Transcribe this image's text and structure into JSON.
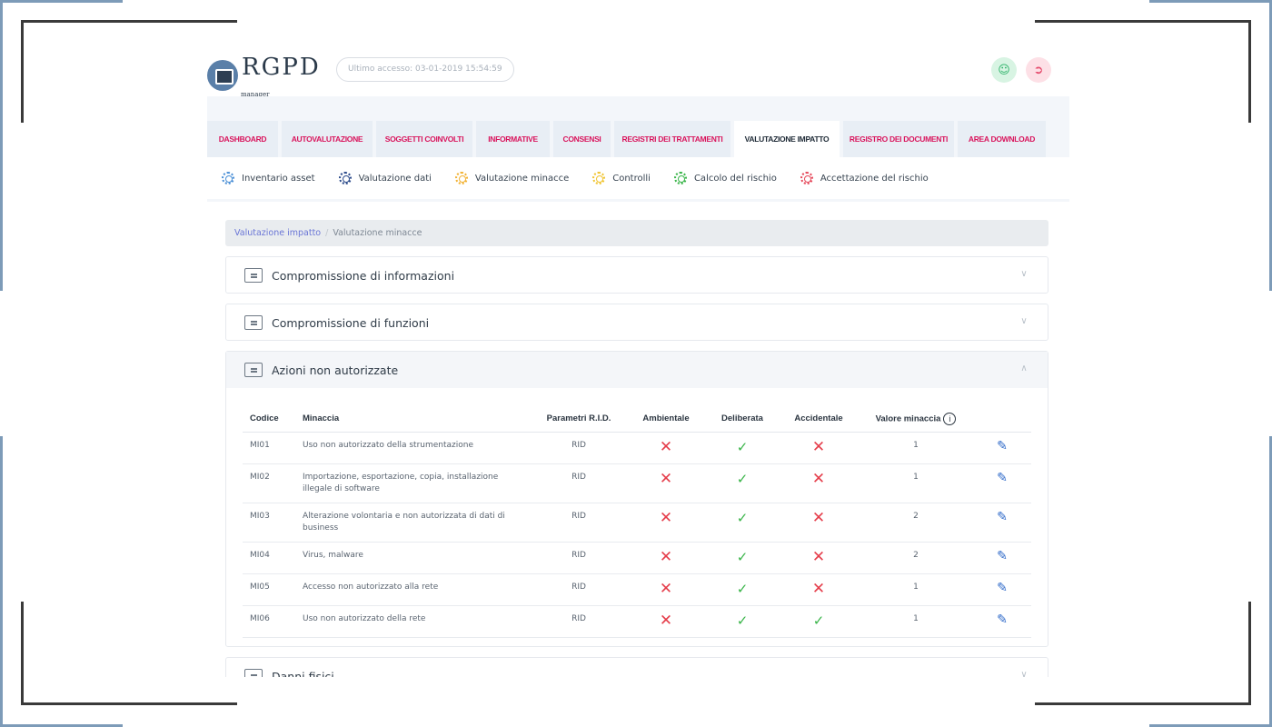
{
  "header": {
    "logo_text": "RGPD",
    "logo_sub": "manager",
    "last_access": "Ultimo accesso: 03-01-2019 15:54:59",
    "colors": {
      "user_btn": "#2fb36a",
      "logout_btn": "#e5486a"
    }
  },
  "tabs": [
    {
      "label": "DASHBOARD"
    },
    {
      "label": "AUTOVALUTAZIONE"
    },
    {
      "label": "SOGGETTI COINVOLTI"
    },
    {
      "label": "INFORMATIVE"
    },
    {
      "label": "CONSENSI"
    },
    {
      "label": "REGISTRI DEI TRATTAMENTI"
    },
    {
      "label": "VALUTAZIONE IMPATTO"
    },
    {
      "label": "REGISTRO DEI DOCUMENTI"
    },
    {
      "label": "AREA DOWNLOAD"
    }
  ],
  "active_tab": "VALUTAZIONE IMPATTO",
  "subnav": [
    {
      "label": "Inventario asset",
      "color": "#4a8fd6"
    },
    {
      "label": "Valutazione dati",
      "color": "#2b4a8a"
    },
    {
      "label": "Valutazione minacce",
      "color": "#f2b233"
    },
    {
      "label": "Controlli",
      "color": "#f0c431"
    },
    {
      "label": "Calcolo del rischio",
      "color": "#3ab54a"
    },
    {
      "label": "Accettazione del rischio",
      "color": "#e5485a"
    }
  ],
  "breadcrumb": {
    "link": "Valutazione impatto",
    "separator": "/",
    "current": "Valutazione minacce"
  },
  "panels": [
    {
      "title": "Compromissione di informazioni",
      "state": "collapsed"
    },
    {
      "title": "Compromissione di funzioni",
      "state": "collapsed"
    },
    {
      "title": "Azioni non autorizzate",
      "state": "expanded"
    },
    {
      "title": "Danni fisici",
      "state": "collapsed"
    }
  ],
  "table": {
    "headers": {
      "codice": "Codice",
      "minaccia": "Minaccia",
      "parametri": "Parametri R.I.D.",
      "ambientale": "Ambientale",
      "deliberata": "Deliberata",
      "accidentale": "Accidentale",
      "valore": "Valore minaccia"
    },
    "rows": [
      {
        "codice": "MI01",
        "minaccia": "Uso non autorizzato della strumentazione",
        "parametri": "RID",
        "ambientale": false,
        "deliberata": true,
        "accidentale": false,
        "valore": "1"
      },
      {
        "codice": "MI02",
        "minaccia": "Importazione, esportazione, copia, installazione illegale di software",
        "parametri": "RID",
        "ambientale": false,
        "deliberata": true,
        "accidentale": false,
        "valore": "1"
      },
      {
        "codice": "MI03",
        "minaccia": "Alterazione volontaria e non autorizzata di dati di business",
        "parametri": "RID",
        "ambientale": false,
        "deliberata": true,
        "accidentale": false,
        "valore": "2"
      },
      {
        "codice": "MI04",
        "minaccia": "Virus, malware",
        "parametri": "RID",
        "ambientale": false,
        "deliberata": true,
        "accidentale": false,
        "valore": "2"
      },
      {
        "codice": "MI05",
        "minaccia": "Accesso non autorizzato alla rete",
        "parametri": "RID",
        "ambientale": false,
        "deliberata": true,
        "accidentale": false,
        "valore": "1"
      },
      {
        "codice": "MI06",
        "minaccia": "Uso non autorizzato della rete",
        "parametri": "RID",
        "ambientale": false,
        "deliberata": true,
        "accidentale": true,
        "valore": "1"
      }
    ]
  }
}
